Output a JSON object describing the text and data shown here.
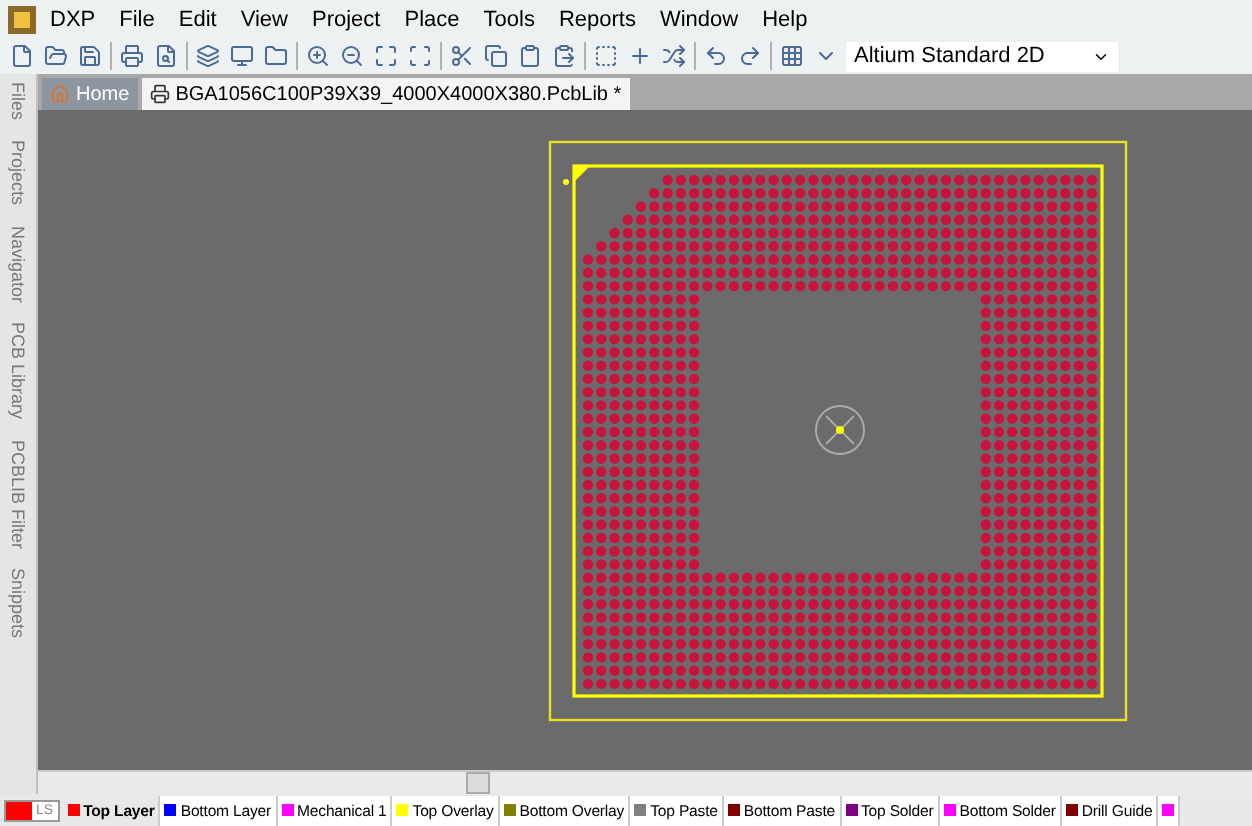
{
  "menu_bar": {
    "logo_label": "DXP",
    "items": [
      "File",
      "Edit",
      "View",
      "Project",
      "Place",
      "Tools",
      "Reports",
      "Window",
      "Help"
    ]
  },
  "toolbar": {
    "view_selector": "Altium Standard 2D"
  },
  "document_tabs": [
    {
      "label": "Home",
      "kind": "home",
      "selected": false
    },
    {
      "label": "BGA1056C100P39X39_4000X4000X380.PcbLib *",
      "kind": "document",
      "selected": true
    }
  ],
  "side_panels": [
    "Files",
    "Projects",
    "Navigator",
    "PCB Library",
    "PCBLIB Filter",
    "Snippets"
  ],
  "layer_bar": {
    "ls_label": "LS",
    "layers": [
      {
        "name": "Top Layer",
        "color": "#ff0000",
        "selected": true
      },
      {
        "name": "Bottom Layer",
        "color": "#0000ff",
        "selected": false
      },
      {
        "name": "Mechanical 1",
        "color": "#ff00ff",
        "selected": false
      },
      {
        "name": "Top Overlay",
        "color": "#ffff00",
        "selected": false
      },
      {
        "name": "Bottom Overlay",
        "color": "#808000",
        "selected": false
      },
      {
        "name": "Top Paste",
        "color": "#808080",
        "selected": false
      },
      {
        "name": "Bottom Paste",
        "color": "#800000",
        "selected": false
      },
      {
        "name": "Top Solder",
        "color": "#800080",
        "selected": false
      },
      {
        "name": "Bottom Solder",
        "color": "#ff00ff",
        "selected": false
      },
      {
        "name": "Drill Guide",
        "color": "#800000",
        "selected": false
      },
      {
        "color": "#ff00ff",
        "selected": false
      }
    ]
  }
}
